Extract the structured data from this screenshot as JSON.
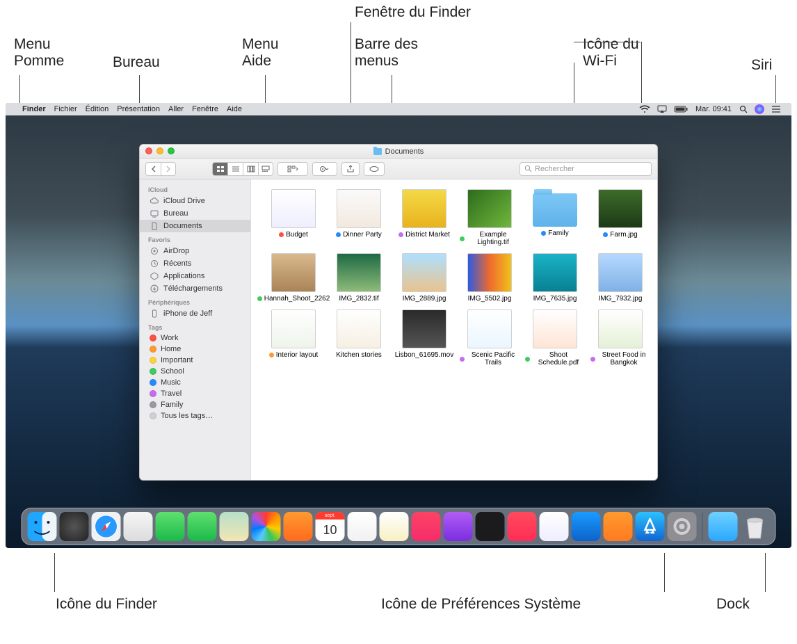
{
  "callouts": {
    "apple_menu": "Menu\nPomme",
    "desktop": "Bureau",
    "help_menu": "Menu\nAide",
    "finder_window": "Fenêtre du Finder",
    "menu_bar": "Barre des\nmenus",
    "wifi": "Icône du\nWi-Fi",
    "siri": "Siri",
    "finder_icon": "Icône du Finder",
    "sysprefs": "Icône de Préférences Système",
    "dock": "Dock"
  },
  "menubar": {
    "app": "Finder",
    "items": [
      "Fichier",
      "Édition",
      "Présentation",
      "Aller",
      "Fenêtre",
      "Aide"
    ],
    "date": "Mar. 09:41"
  },
  "finder": {
    "title": "Documents",
    "search_placeholder": "Rechercher",
    "sidebar": {
      "sections": [
        {
          "head": "iCloud",
          "items": [
            {
              "label": "iCloud Drive",
              "icon": "cloud"
            },
            {
              "label": "Bureau",
              "icon": "desktop"
            },
            {
              "label": "Documents",
              "icon": "doc",
              "selected": true
            }
          ]
        },
        {
          "head": "Favoris",
          "items": [
            {
              "label": "AirDrop",
              "icon": "airdrop"
            },
            {
              "label": "Récents",
              "icon": "clock"
            },
            {
              "label": "Applications",
              "icon": "app"
            },
            {
              "label": "Téléchargements",
              "icon": "download"
            }
          ]
        },
        {
          "head": "Périphériques",
          "items": [
            {
              "label": "iPhone de Jeff",
              "icon": "phone"
            }
          ]
        },
        {
          "head": "Tags",
          "items": [
            {
              "label": "Work",
              "tag": "#ff4e43"
            },
            {
              "label": "Home",
              "tag": "#ff9a2f"
            },
            {
              "label": "Important",
              "tag": "#ffd335"
            },
            {
              "label": "School",
              "tag": "#3ecb5f"
            },
            {
              "label": "Music",
              "tag": "#2889ff"
            },
            {
              "label": "Travel",
              "tag": "#c56cf0"
            },
            {
              "label": "Family",
              "tag": "#9a9a9f"
            },
            {
              "label": "Tous les tags…",
              "tag": "#d0d0d4"
            }
          ]
        }
      ]
    },
    "files": [
      {
        "name": "Budget",
        "tag": "#ff4e43",
        "bg": "linear-gradient(#fff,#eef)"
      },
      {
        "name": "Dinner Party",
        "tag": "#2889ff",
        "bg": "linear-gradient(#fafafa,#f2e9df)"
      },
      {
        "name": "District Market",
        "tag": "#c56cf0",
        "bg": "linear-gradient(#f4d947,#e8b21e)"
      },
      {
        "name": "Example Lighting.tif",
        "tag": "#3ecb5f",
        "bg": "linear-gradient(135deg,#2e6b1d,#6fb83b)"
      },
      {
        "name": "Family",
        "tag": "#2889ff",
        "folder": true
      },
      {
        "name": "Farm.jpg",
        "tag": "#2889ff",
        "bg": "linear-gradient(#3d6b2a,#1c3a16)"
      },
      {
        "name": "Hannah_Shoot_2262",
        "tag": "#3ecb5f",
        "bg": "linear-gradient(#d9b98e,#a98457)"
      },
      {
        "name": "IMG_2832.tif",
        "bg": "linear-gradient(#1f6a44,#8dbb79)"
      },
      {
        "name": "IMG_2889.jpg",
        "bg": "linear-gradient(#aee0ff,#e9c38e)"
      },
      {
        "name": "IMG_5502.jpg",
        "bg": "linear-gradient(90deg,#2f5adf,#ef6a2e,#f0c11a)"
      },
      {
        "name": "IMG_7635.jpg",
        "bg": "linear-gradient(#1bb3c7,#088093)"
      },
      {
        "name": "IMG_7932.jpg",
        "bg": "linear-gradient(#b6d9ff,#7fb1e6)"
      },
      {
        "name": "Interior layout",
        "tag": "#ff9a2f",
        "bg": "linear-gradient(#fff,#eef4ea)"
      },
      {
        "name": "Kitchen stories",
        "bg": "linear-gradient(#fff,#f6efe3)"
      },
      {
        "name": "Lisbon_61695.mov",
        "bg": "linear-gradient(#2a2a2a,#555)"
      },
      {
        "name": "Scenic Pacific Trails",
        "tag": "#c56cf0",
        "bg": "linear-gradient(#fff,#eaf6ff)"
      },
      {
        "name": "Shoot Schedule.pdf",
        "tag": "#3ecb5f",
        "bg": "linear-gradient(#fff,#ffe4d5)"
      },
      {
        "name": "Street Food in Bangkok",
        "tag": "#c56cf0",
        "bg": "linear-gradient(#fff,#e5f0d6)"
      }
    ]
  },
  "dock": {
    "icons": [
      {
        "name": "finder",
        "bg": "linear-gradient(#2aa7ff,#1065d1)"
      },
      {
        "name": "launchpad",
        "bg": "radial-gradient(circle,#555,#222)"
      },
      {
        "name": "safari",
        "bg": "radial-gradient(circle,#fff 30%,#2a99ff 32%)"
      },
      {
        "name": "mail",
        "bg": "linear-gradient(#f6f6f6,#dcdcdc)"
      },
      {
        "name": "messages",
        "bg": "linear-gradient(#5ee06f,#1bb94a)"
      },
      {
        "name": "facetime",
        "bg": "linear-gradient(#5ee06f,#1bb94a)"
      },
      {
        "name": "maps",
        "bg": "linear-gradient(#b6e0c9,#f2e6b3)"
      },
      {
        "name": "photos",
        "bg": "conic-gradient(#ff3b30,#ff9500,#ffcc00,#34c759,#5ac8fa,#007aff,#af52de,#ff3b30)"
      },
      {
        "name": "photobooth",
        "bg": "linear-gradient(#ff9a2f,#ff6a1f)"
      },
      {
        "name": "calendar",
        "bg": "linear-gradient(#fff,#f1f1f1)",
        "text": "10",
        "top": "sept."
      },
      {
        "name": "reminders",
        "bg": "linear-gradient(#fff,#f1f1f1)"
      },
      {
        "name": "notes",
        "bg": "linear-gradient(#fff,#f7f0c4)"
      },
      {
        "name": "music",
        "bg": "linear-gradient(#fb4365,#f72c6b)"
      },
      {
        "name": "podcasts",
        "bg": "linear-gradient(#b25cf5,#7a2ee0)"
      },
      {
        "name": "tv",
        "bg": "#1b1b1e"
      },
      {
        "name": "news",
        "bg": "linear-gradient(#ff4a5d,#ff2d55)"
      },
      {
        "name": "numbers",
        "bg": "linear-gradient(#fff,#eef)"
      },
      {
        "name": "keynote",
        "bg": "linear-gradient(#1a9bff,#0d62c9)"
      },
      {
        "name": "pages",
        "bg": "linear-gradient(#ff9a2f,#ff7a1f)"
      },
      {
        "name": "appstore",
        "bg": "linear-gradient(#2aa7ff,#1065d1)"
      },
      {
        "name": "sysprefs",
        "bg": "linear-gradient(#8e8e93,#5c5c61)"
      }
    ],
    "right": [
      {
        "name": "downloads",
        "bg": "linear-gradient(#6fd2ff,#2aa7ff)"
      },
      {
        "name": "trash",
        "bg": "linear-gradient(#f1f1f3,#d2d2d5)"
      }
    ]
  }
}
